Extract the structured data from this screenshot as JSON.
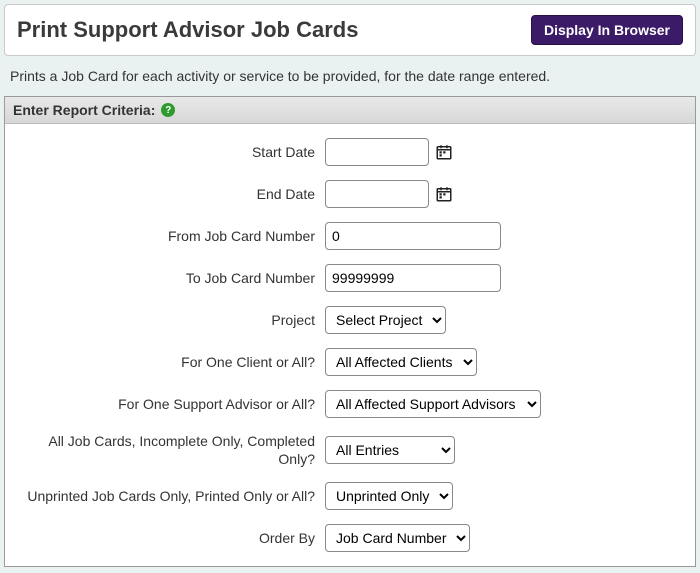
{
  "header": {
    "title": "Print Support Advisor Job Cards",
    "display_btn": "Display In Browser"
  },
  "description": "Prints a Job Card for each activity or service to be provided, for the date range entered.",
  "panel": {
    "title": "Enter Report Criteria:",
    "help_glyph": "?"
  },
  "fields": {
    "start_date": {
      "label": "Start Date",
      "value": ""
    },
    "end_date": {
      "label": "End Date",
      "value": ""
    },
    "from_no": {
      "label": "From Job Card Number",
      "value": "0"
    },
    "to_no": {
      "label": "To Job Card Number",
      "value": "99999999"
    },
    "project": {
      "label": "Project",
      "selected": "Select Project"
    },
    "client": {
      "label": "For One Client or All?",
      "selected": "All Affected Clients"
    },
    "advisor": {
      "label": "For One Support Advisor or All?",
      "selected": "All Affected Support Advisors"
    },
    "completion": {
      "label": "All Job Cards, Incomplete Only, Completed Only?",
      "selected": "All Entries"
    },
    "printed": {
      "label": "Unprinted Job Cards Only, Printed Only or All?",
      "selected": "Unprinted Only"
    },
    "order_by": {
      "label": "Order By",
      "selected": "Job Card Number"
    }
  }
}
